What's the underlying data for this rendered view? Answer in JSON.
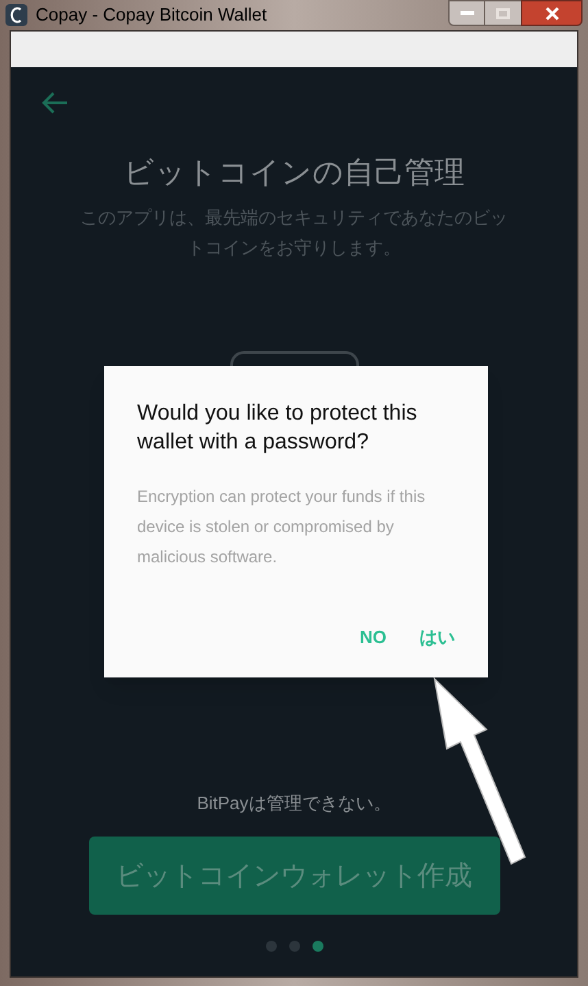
{
  "window": {
    "title": "Copay - Copay Bitcoin Wallet"
  },
  "screen": {
    "title": "ビットコインの自己管理",
    "subtitle": "このアプリは、最先端のセキュリティであなたのビットコインをお守りします。",
    "note": "BitPayは管理できない。",
    "create_button": "ビットコインウォレット作成",
    "pager": [
      {
        "selected": false
      },
      {
        "selected": false
      },
      {
        "selected": true
      }
    ]
  },
  "dialog": {
    "title": "Would you like to protect this wallet with a password?",
    "message": "Encryption can protect your funds if this device is stolen or compromised by malicious software.",
    "buttons": [
      "NO",
      "はい"
    ]
  }
}
